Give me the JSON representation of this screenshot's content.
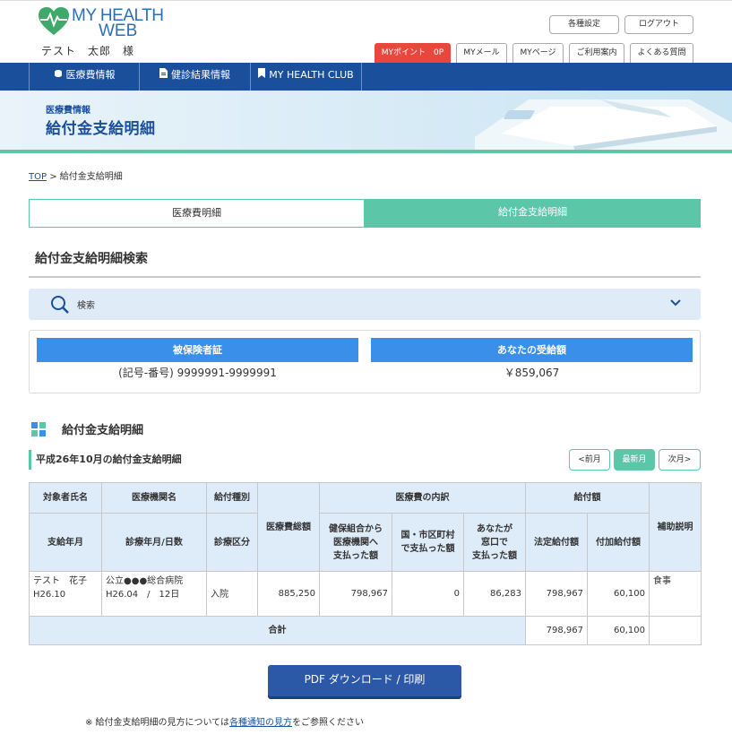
{
  "header": {
    "logo_line1": "MY HEALTH",
    "logo_line2": "WEB",
    "user_name": "テスト　太郎　様",
    "settings_label": "各種設定",
    "logout_label": "ログアウト",
    "tabs": {
      "mypoint": "MYポイント　0P",
      "mymail": "MYメール",
      "mypage": "MYページ",
      "guide": "ご利用案内",
      "faq": "よくある質問"
    }
  },
  "nav": {
    "medical": "医療費情報",
    "checkup": "健診結果情報",
    "club": "MY HEALTH CLUB"
  },
  "banner": {
    "subtitle": "医療費情報",
    "title": "給付金支給明細"
  },
  "breadcrumb": {
    "top": "TOP",
    "separator": ">",
    "current": "給付金支給明細"
  },
  "page_tabs": {
    "medical": "医療費明細",
    "benefit": "給付金支給明細"
  },
  "search": {
    "title": "給付金支給明細検索",
    "label": "検索"
  },
  "info": {
    "insured_header": "被保険者証",
    "insured_value": "(記号-番号) 9999991-9999991",
    "amount_header": "あなたの受給額",
    "amount_value": "￥859,067"
  },
  "details": {
    "title": "給付金支給明細",
    "month_title": "平成26年10月の給付金支給明細",
    "prev": "<前月",
    "latest": "最新月",
    "next": "次月>"
  },
  "table": {
    "h_name": "対象者氏名",
    "h_institution": "医療機関名",
    "h_type": "給付種別",
    "h_medical_total": "医療費総額",
    "h_breakdown": "医療費の内訳",
    "h_benefit": "給付額",
    "h_note": "補助説明",
    "h_paid_month": "支給年月",
    "h_exam_date": "診療年月/日数",
    "h_category": "診療区分",
    "h_union": "健保組合から\n医療機関へ\n支払った額",
    "h_city": "国・市区町村\nで支払った額",
    "h_you": "あなたが\n窓口で\n支払った額",
    "h_decided": "法定給付額",
    "h_additional": "付加給付額",
    "row": {
      "name": "テスト　花子",
      "paid_month": "H26.10",
      "institution": "公立●●●総合病院",
      "exam_date": "H26.04　/　12日",
      "category": "入院",
      "medical_total": "885,250",
      "union": "798,967",
      "city": "0",
      "you": "86,283",
      "decided": "798,967",
      "additional": "60,100",
      "note": "食事"
    },
    "total": {
      "label": "合計",
      "decided": "798,967",
      "additional": "60,100"
    }
  },
  "pdf_button": "PDF ダウンロード / 印刷",
  "note": {
    "prefix": "※ 給付金支給明細の見方については",
    "link": "各種通知の見方",
    "suffix": "をご参照ください"
  }
}
